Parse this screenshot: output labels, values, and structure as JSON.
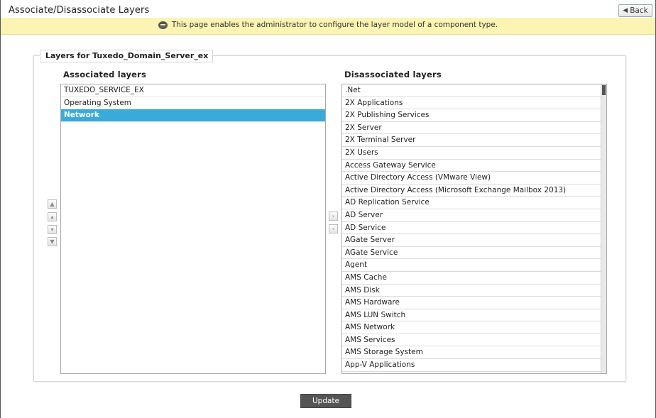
{
  "header": {
    "title": "Associate/Disassociate Layers",
    "back_label": "Back"
  },
  "info_bar": {
    "message": "This page enables the administrator to configure the layer model of a component type."
  },
  "panel": {
    "legend": "Layers for Tuxedo_Domain_Server_ex",
    "associated_label": "Associated layers",
    "disassociated_label": "Disassociated layers",
    "associated_layers": [
      "TUXEDO_SERVICE_EX",
      "Operating System",
      "Network"
    ],
    "selected_associated": "Network",
    "disassociated_layers": [
      ".Net",
      "2X Applications",
      "2X Publishing Services",
      "2X Server",
      "2X Terminal Server",
      "2X Users",
      "Access Gateway Service",
      "Active Directory Access (VMware View)",
      "Active Directory Access (Microsoft Exchange Mailbox 2013)",
      "AD Replication Service",
      "AD Server",
      "AD Service",
      "AGate Server",
      "AGate Service",
      "Agent",
      "AMS Cache",
      "AMS Disk",
      "AMS Hardware",
      "AMS LUN Switch",
      "AMS Network",
      "AMS Services",
      "AMS Storage System",
      "App-V Applications"
    ]
  },
  "footer": {
    "update_label": "Update"
  },
  "colors": {
    "selection": "#3aaadb",
    "info_background": "#fbf4b2",
    "update_button": "#555555"
  }
}
